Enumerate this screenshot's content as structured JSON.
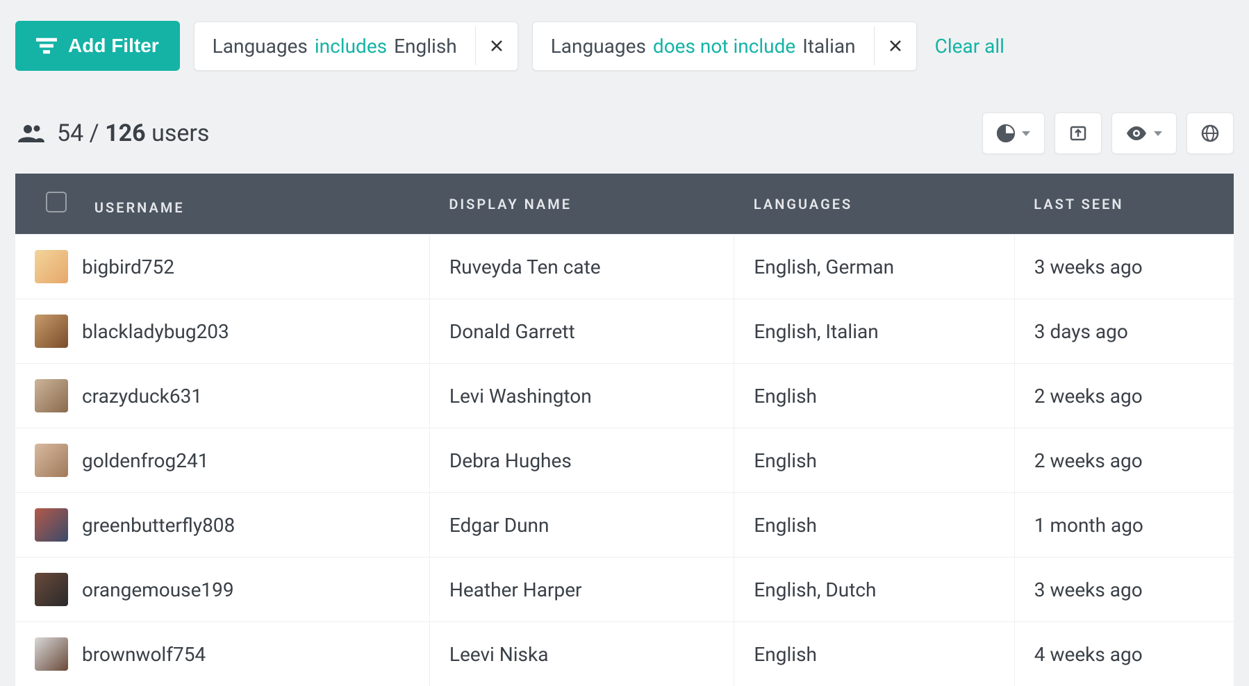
{
  "toolbar": {
    "add_filter_label": "Add Filter",
    "clear_all_label": "Clear all"
  },
  "filters": [
    {
      "field": "Languages",
      "op": "includes",
      "value": "English"
    },
    {
      "field": "Languages",
      "op": "does not include",
      "value": "Italian"
    }
  ],
  "count": {
    "filtered": "54",
    "separator": "/",
    "total": "126",
    "noun": "users"
  },
  "columns": {
    "username": "USERNAME",
    "display_name": "DISPLAY NAME",
    "languages": "LANGUAGES",
    "last_seen": "LAST SEEN"
  },
  "rows": [
    {
      "username": "bigbird752",
      "display_name": "Ruveyda Ten cate",
      "languages": "English, German",
      "last_seen": "3 weeks ago",
      "avatar_bg": "linear-gradient(135deg,#f3d49a,#e6a76a)"
    },
    {
      "username": "blackladybug203",
      "display_name": "Donald Garrett",
      "languages": "English, Italian",
      "last_seen": "3 days ago",
      "avatar_bg": "linear-gradient(135deg,#c79b6a,#7a4d2a)"
    },
    {
      "username": "crazyduck631",
      "display_name": "Levi Washington",
      "languages": "English",
      "last_seen": "2 weeks ago",
      "avatar_bg": "linear-gradient(135deg,#cbb49a,#8a6a4d)"
    },
    {
      "username": "goldenfrog241",
      "display_name": "Debra Hughes",
      "languages": "English",
      "last_seen": "2 weeks ago",
      "avatar_bg": "linear-gradient(135deg,#d8b9a0,#a07a5a)"
    },
    {
      "username": "greenbutterfly808",
      "display_name": "Edgar Dunn",
      "languages": "English",
      "last_seen": "1 month ago",
      "avatar_bg": "linear-gradient(135deg,#b35a4a,#3a4a6a)"
    },
    {
      "username": "orangemouse199",
      "display_name": "Heather Harper",
      "languages": "English, Dutch",
      "last_seen": "3 weeks ago",
      "avatar_bg": "linear-gradient(135deg,#6a4a3a,#2a2a2a)"
    },
    {
      "username": "brownwolf754",
      "display_name": "Leevi Niska",
      "languages": "English",
      "last_seen": "4 weeks ago",
      "avatar_bg": "linear-gradient(135deg,#d8d8d8,#6a4a3a)"
    }
  ]
}
